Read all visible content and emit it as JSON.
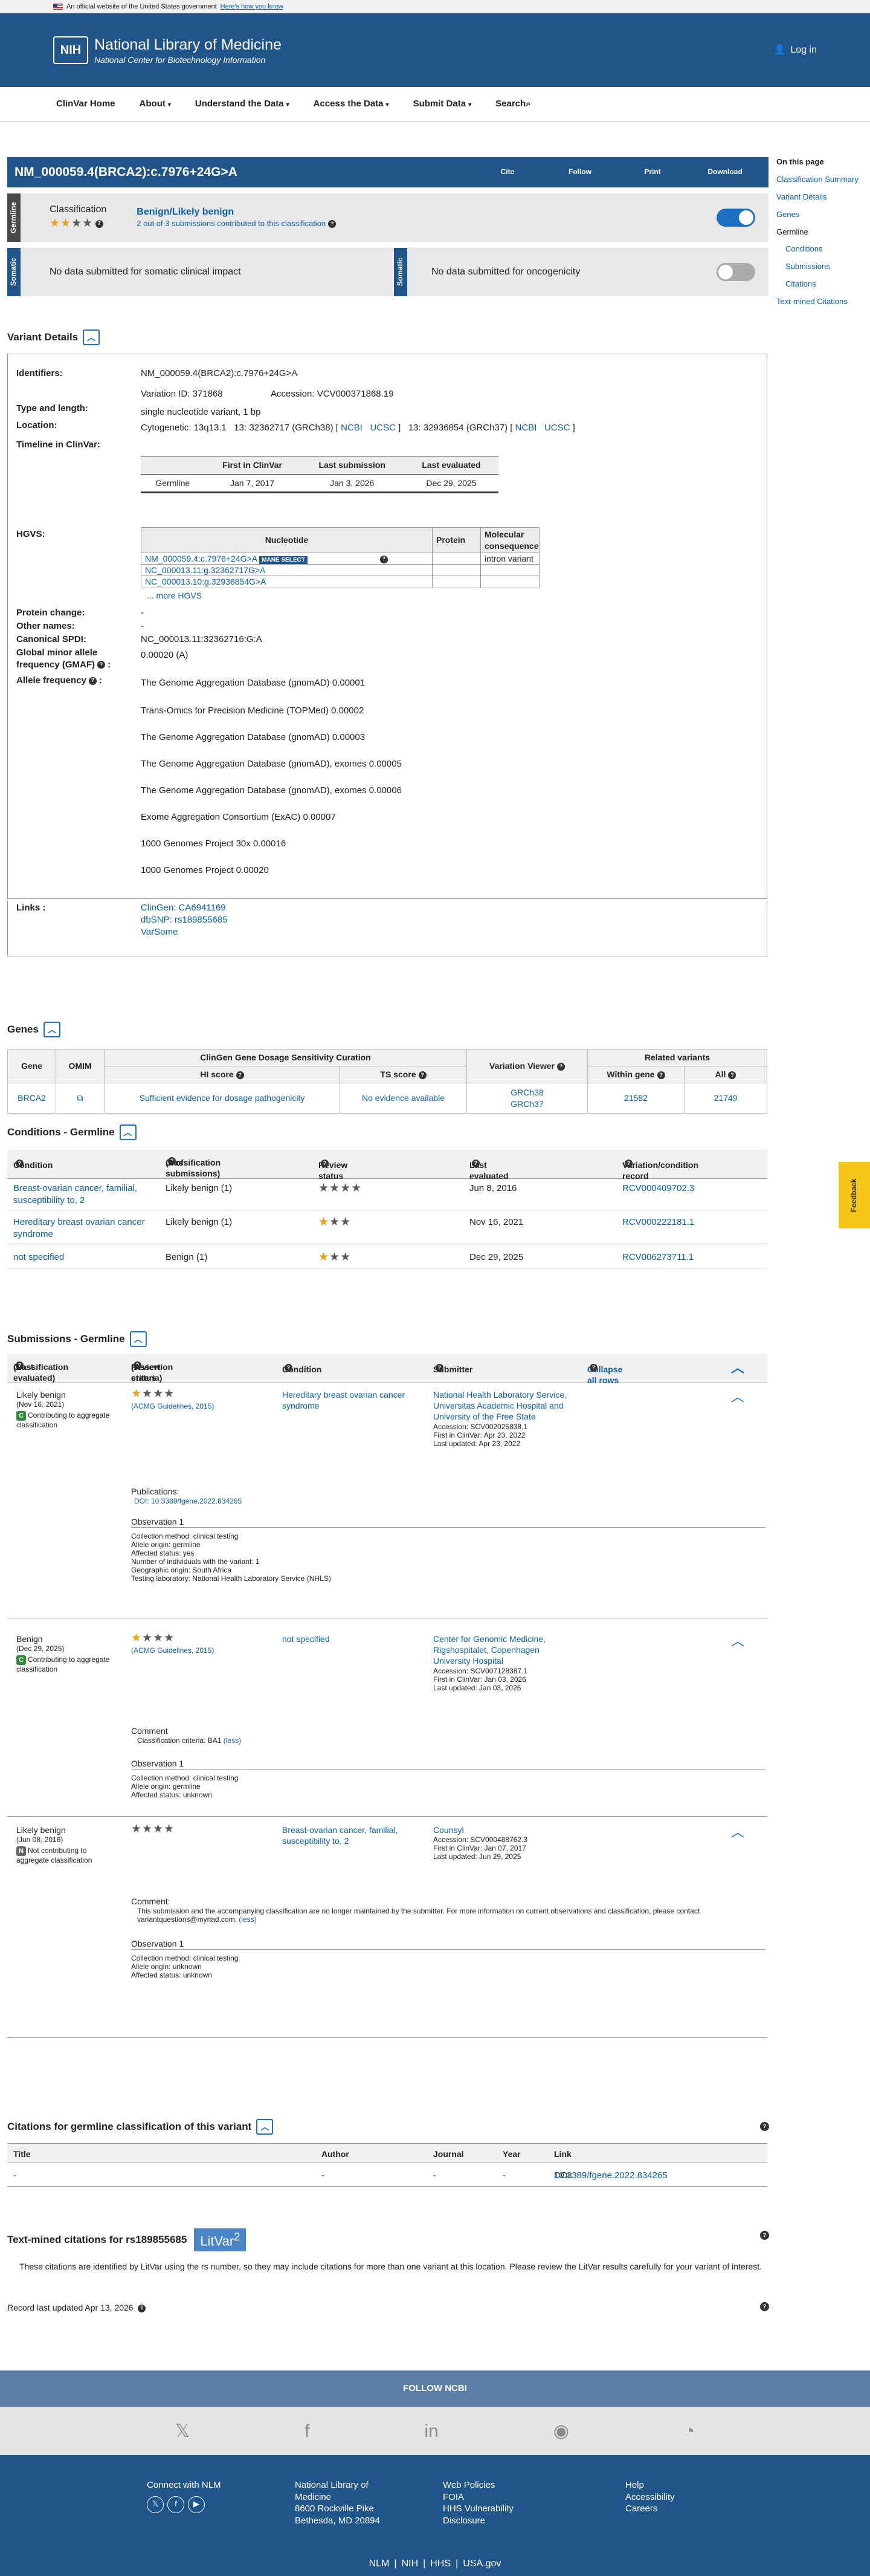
{
  "gov_banner": {
    "text": "An official website of the United States government",
    "link": "Here's how you know"
  },
  "header": {
    "nih": "NIH",
    "title": "National Library of Medicine",
    "subtitle": "National Center for Biotechnology Information",
    "login": "Log in"
  },
  "nav": [
    "ClinVar Home",
    "About",
    "Understand the Data",
    "Access the Data",
    "Submit Data",
    "Search"
  ],
  "on_this_page": {
    "title": "On this page",
    "items": [
      "Classification Summary",
      "Variant Details",
      "Genes",
      "Germline"
    ],
    "sub_items": [
      "Conditions",
      "Submissions",
      "Citations"
    ],
    "last": "Text-mined Citations"
  },
  "title_bar": {
    "title": "NM_000059.4(BRCA2):c.7976+24G>A",
    "actions": [
      "Cite",
      "Follow",
      "Print",
      "Download"
    ]
  },
  "germline": {
    "tab": "Germline",
    "label": "Classification",
    "classification": "Benign/Likely benign",
    "submissions_note": "2 out of 3 submissions contributed to this classification"
  },
  "somatic": {
    "tab": "Somatic",
    "clinical": "No data submitted for somatic clinical impact",
    "onco": "No data submitted for oncogenicity"
  },
  "variant_details": {
    "heading": "Variant Details",
    "identifiers_label": "Identifiers:",
    "identifiers": "NM_000059.4(BRCA2):c.7976+24G>A",
    "variation_id": "Variation ID: 371868",
    "accession": "Accession: VCV000371868.19",
    "type_label": "Type and length:",
    "type": "single nucleotide variant, 1 bp",
    "location_label": "Location:",
    "cytogenetic": "Cytogenetic: 13q13.1",
    "loc38": "13: 32362717 (GRCh38)",
    "loc37": "13: 32936854 (GRCh37)",
    "ncbi": "NCBI",
    "ucsc": "UCSC",
    "timeline_label": "Timeline in ClinVar:",
    "timeline_headers": [
      "First in ClinVar",
      "Last submission",
      "Last evaluated"
    ],
    "timeline_row": [
      "Germline",
      "Jan 7, 2017",
      "Jan 3, 2026",
      "Dec 29, 2025"
    ],
    "hgvs_label": "HGVS:",
    "hgvs_headers": [
      "Nucleotide",
      "Protein",
      "Molecular consequence"
    ],
    "hgvs_rows": [
      "NM_000059.4:c.7976+24G>A",
      "NC_000013.11:g.32362717G>A",
      "NC_000013.10:g.32936854G>A"
    ],
    "mane": "MANE SELECT",
    "consequence": "intron variant",
    "more_hgvs": "... more HGVS",
    "protein_change_label": "Protein change:",
    "protein_change": "-",
    "other_names_label": "Other names:",
    "other_names": "-",
    "spdi_label": "Canonical SPDI:",
    "spdi": "NC_000013.11:32362716:G:A",
    "gmaf_label": "Global minor allele frequency (GMAF)",
    "gmaf": "0.00020 (A)",
    "allele_label": "Allele frequency",
    "alleles": [
      "The Genome Aggregation Database (gnomAD) 0.00001",
      "Trans-Omics for Precision Medicine (TOPMed) 0.00002",
      "The Genome Aggregation Database (gnomAD) 0.00003",
      "The Genome Aggregation Database (gnomAD), exomes 0.00005",
      "The Genome Aggregation Database (gnomAD), exomes 0.00006",
      "Exome Aggregation Consortium (ExAC) 0.00007",
      "1000 Genomes Project 30x 0.00016",
      "1000 Genomes Project 0.00020"
    ],
    "links_label": "Links :",
    "links": [
      "ClinGen: CA6941169",
      "dbSNP: rs189855685",
      "VarSome"
    ]
  },
  "genes": {
    "heading": "Genes",
    "headers": [
      "Gene",
      "OMIM",
      "ClinGen Gene Dosage Sensitivity Curation",
      "HI score",
      "TS score",
      "Variation Viewer",
      "Related variants",
      "Within gene",
      "All"
    ],
    "row": {
      "gene": "BRCA2",
      "hi": "Sufficient evidence for dosage pathogenicity",
      "ts": "No evidence available",
      "grch38": "GRCh38",
      "grch37": "GRCh37",
      "within": "21582",
      "all": "21749"
    }
  },
  "conditions": {
    "heading": "Conditions - Germline",
    "headers": [
      "Condition",
      "Classification",
      "(# of submissions)",
      "Review status",
      "Last evaluated",
      "Variation/condition record"
    ],
    "rows": [
      {
        "condition": "Breast-ovarian cancer, familial, susceptibility to, 2",
        "classification": "Likely benign (1)",
        "evaluated": "Jun 8, 2016",
        "record": "RCV000409702.3"
      },
      {
        "condition": "Hereditary breast ovarian cancer syndrome",
        "classification": "Likely benign (1)",
        "evaluated": "Nov 16, 2021",
        "record": "RCV000222181.1"
      },
      {
        "condition": "not specified",
        "classification": "Benign (1)",
        "evaluated": "Dec 29, 2025",
        "record": "RCV006273711.1"
      }
    ]
  },
  "submissions": {
    "heading": "Submissions - Germline",
    "headers": [
      "Classification",
      "(Last evaluated)",
      "Review status",
      "(Assertion criteria)",
      "Condition",
      "Submitter",
      "Collapse all rows"
    ],
    "s1": {
      "class": "Likely benign",
      "date": "(Nov 16, 2021)",
      "contrib": "Contributing to aggregate classification",
      "criteria": "(ACMG Guidelines, 2015)",
      "condition": "Hereditary breast ovarian cancer syndrome",
      "submitter": "National Health Laboratory Service, Universitas Academic Hospital and University of the Free State",
      "acc": "Accession: SCV002025838.1",
      "first": "First in ClinVar: Apr 23, 2022",
      "updated": "Last updated: Apr 23, 2022",
      "pubs": "Publications:",
      "doi": "DOI: 10.3389/fgene.2022.834265",
      "obs": "Observation 1",
      "lines": [
        "Collection method: clinical testing",
        "Allele origin: germline",
        "Affected status: yes",
        "Number of individuals with the variant: 1",
        "Geographic origin: South Africa",
        "Testing laboratory: National Health Laboratory Service (NHLS)"
      ]
    },
    "s2": {
      "class": "Benign",
      "date": "(Dec 29, 2025)",
      "contrib": "Contributing to aggregate classification",
      "criteria": "(ACMG Guidelines, 2015)",
      "condition": "not specified",
      "submitter": "Center for Genomic Medicine, Rigshospitalet, Copenhagen University Hospital",
      "acc": "Accession: SCV007128387.1",
      "first": "First in ClinVar: Jan 03, 2026",
      "updated": "Last updated: Jan 03, 2026",
      "comment": "Comment",
      "comment_text": "Classification criteria: BA1",
      "less": "(less)",
      "obs": "Observation 1",
      "lines": [
        "Collection method: clinical testing",
        "Allele origin: germline",
        "Affected status: unknown"
      ]
    },
    "s3": {
      "class": "Likely benign",
      "date": "(Jun 08, 2016)",
      "contrib": "Not contributing to aggregate classification",
      "condition": "Breast-ovarian cancer, familial, susceptibility to, 2",
      "submitter": "Counsyl",
      "acc": "Accession: SCV000488762.3",
      "first": "First in ClinVar: Jan 07, 2017",
      "updated": "Last updated: Jun 29, 2025",
      "comment": "Comment:",
      "comment_text": "This submission and the accompanying classification are no longer maintained by the submitter. For more information on current observations and classification, please contact variantquestions@myriad.com.",
      "less": "(less)",
      "obs": "Observation 1",
      "lines": [
        "Collection method: clinical testing",
        "Allele origin: unknown",
        "Affected status: unknown"
      ]
    }
  },
  "citations": {
    "heading": "Citations for germline classification of this variant",
    "headers": [
      "Title",
      "Author",
      "Journal",
      "Year",
      "Link"
    ],
    "row": [
      "-",
      "-",
      "-",
      "-"
    ],
    "doi_label": "DOI:",
    "doi": "10.3389/fgene.2022.834265"
  },
  "textmined": {
    "heading": "Text-mined citations for rs189855685",
    "litvar": "LitVar",
    "litvar_sup": "2",
    "note": "These citations are identified by LitVar using the rs number, so they may include citations for more than one variant at this location. Please review the LitVar results carefully for your variant of interest."
  },
  "record_updated": "Record last updated Apr 13, 2026",
  "feedback": "Feedback",
  "footer": {
    "follow": "FOLLOW NCBI",
    "connect": "Connect with NLM",
    "nlm_title": "National Library of Medicine",
    "address1": "8600 Rockville Pike",
    "address2": "Bethesda, MD 20894",
    "col3": [
      "Web Policies",
      "FOIA",
      "HHS Vulnerability Disclosure"
    ],
    "col4": [
      "Help",
      "Accessibility",
      "Careers"
    ],
    "bottom": [
      "NLM",
      "NIH",
      "HHS",
      "USA.gov"
    ]
  }
}
